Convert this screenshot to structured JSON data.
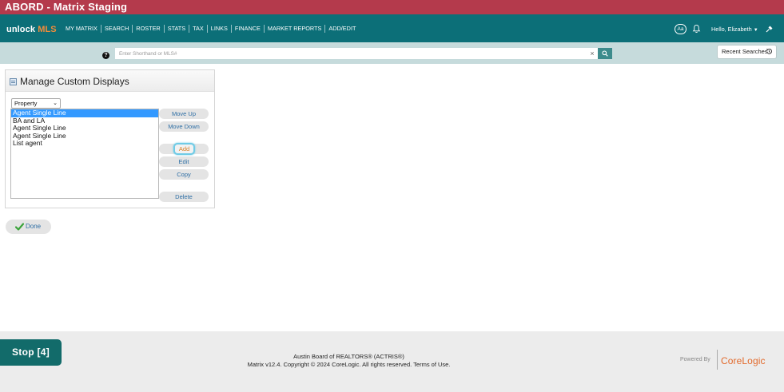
{
  "window": {
    "title": "ABORD - Matrix Staging"
  },
  "navbar": {
    "logo_unlock": "unlock",
    "logo_mls": "MLS",
    "items": [
      "MY MATRIX",
      "SEARCH",
      "ROSTER",
      "STATS",
      "TAX",
      "LINKS",
      "FINANCE",
      "MARKET REPORTS",
      "ADD/EDIT"
    ],
    "font_size_label": "Aa",
    "greeting": "Hello, Elizabeth"
  },
  "search": {
    "placeholder": "Enter Shorthand or MLS#",
    "help_label": "?",
    "clear_label": "×",
    "recent_label": "Recent Searches"
  },
  "panel": {
    "title": "Manage Custom Displays",
    "type_select": {
      "selected": "Property"
    },
    "displays": [
      "Agent Single Line",
      "BA and LA",
      "Agent Single Line",
      "Agent Single Line",
      "List agent"
    ],
    "selected_index": 0,
    "buttons": {
      "move_up": "Move Up",
      "move_down": "Move Down",
      "add": "Add",
      "edit": "Edit",
      "copy": "Copy",
      "delete": "Delete"
    }
  },
  "done_label": "Done",
  "footer": {
    "stop_label": "Stop [4]",
    "line1": "Austin Board of REALTORS® (ACTRIS®)",
    "line2": "Matrix v12.4. Copyright © 2024 CoreLogic. All rights reserved. Terms of Use.",
    "powered_by": "Powered By",
    "brand": "CoreLogic"
  },
  "colors": {
    "titlebar": "#b43a4c",
    "navbar": "#0c6f78",
    "searchbar": "#c6dbdc",
    "selection": "#3399ff",
    "link": "#2f6fa5",
    "brand": "#e26a2c",
    "stop": "#126b6a"
  }
}
